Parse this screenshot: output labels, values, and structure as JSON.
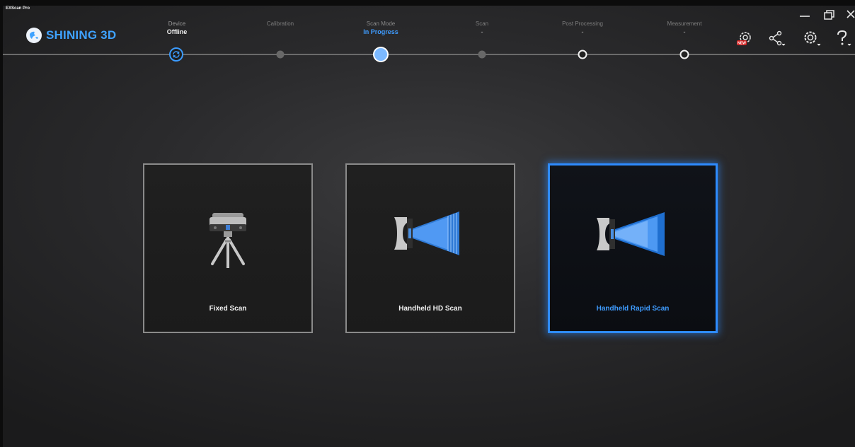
{
  "window": {
    "title": "EXScan Pro",
    "controls": [
      "minimize-icon",
      "restore-icon",
      "close-icon"
    ]
  },
  "brand": {
    "name": "SHINING 3D",
    "color": "#3fa2ff"
  },
  "steps": [
    {
      "name": "Device",
      "status": "Offline",
      "state": "done",
      "icon": "refresh-icon"
    },
    {
      "name": "Calibration",
      "status": "",
      "state": "pending"
    },
    {
      "name": "Scan Mode",
      "status": "In Progress",
      "state": "active"
    },
    {
      "name": "Scan",
      "status": "-",
      "state": "pending"
    },
    {
      "name": "Post Processing",
      "status": "-",
      "state": "pending"
    },
    {
      "name": "Measurement",
      "status": "-",
      "state": "pending"
    }
  ],
  "toolbar": {
    "new_badge": "NEW",
    "icons": [
      "new-feature-gear-icon",
      "share-icon",
      "settings-icon",
      "help-icon"
    ]
  },
  "scan_modes": [
    {
      "label": "Fixed Scan",
      "icon": "tripod-scanner-icon",
      "selected": false
    },
    {
      "label": "Handheld HD Scan",
      "icon": "handheld-hd-scanner-icon",
      "selected": false
    },
    {
      "label": "Handheld Rapid Scan",
      "icon": "handheld-rapid-scanner-icon",
      "selected": true
    }
  ],
  "colors": {
    "accent": "#2e8bff",
    "active_text": "#3f9cff",
    "background": "#2a2a2c"
  }
}
